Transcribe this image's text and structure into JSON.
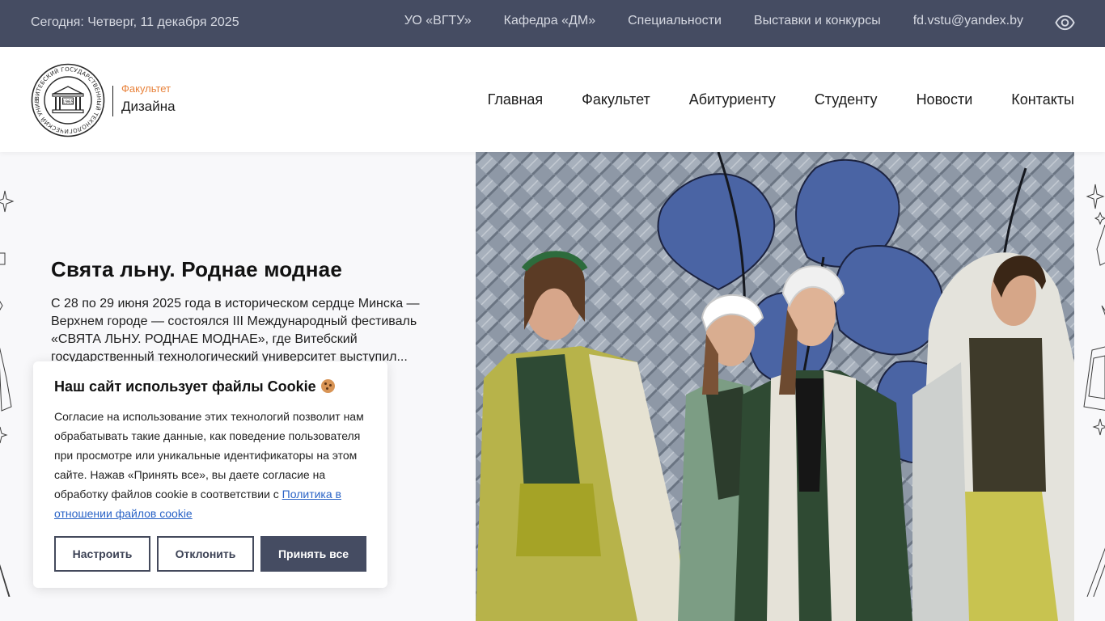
{
  "topbar": {
    "date": "Сегодня: Четверг, 11 декабря 2025",
    "links": [
      "УО «ВГТУ»",
      "Кафедра «ДМ»",
      "Специальности",
      "Выставки и конкурсы",
      "fd.vstu@yandex.by"
    ],
    "accessibility_icon": "eye-icon"
  },
  "logo": {
    "small": "Факультет",
    "big": "Дизайна",
    "seal_year": "1965",
    "seal_ring_text": "ВИТЕБСКИЙ ГОСУДАРСТВЕННЫЙ ТЕХНОЛОГИЧЕСКИЙ УНИВЕРСИТЕТ"
  },
  "nav": [
    "Главная",
    "Факультет",
    "Абитуриенту",
    "Студенту",
    "Новости",
    "Контакты"
  ],
  "hero": {
    "title": "Свята льну. Роднае моднае",
    "text": "С 28 по 29 июня 2025 года в историческом сердце Минска — Верхнем городе — состоялся III Международный фестиваль «СВЯТА ЛЬНУ. РОДНАЕ МОДНАЕ», где Витебский государственный технологический университет выступил..."
  },
  "cookie": {
    "title": "Наш сайт использует файлы Cookie",
    "text": "Согласие на использование этих технологий позволит нам обрабатывать такие данные, как поведение пользователя при просмотре или уникальные идентификаторы на этом сайте. Нажав «Принять все», вы даете согласие на обработку файлов cookie в соответствии с ",
    "link": "Политика в отношении файлов cookie",
    "buttons": {
      "settings": "Настроить",
      "decline": "Отклонить",
      "accept": "Принять все"
    }
  },
  "colors": {
    "topbar_bg": "#454c62",
    "accent_orange": "#e8823b",
    "link_blue": "#2a63c6"
  }
}
